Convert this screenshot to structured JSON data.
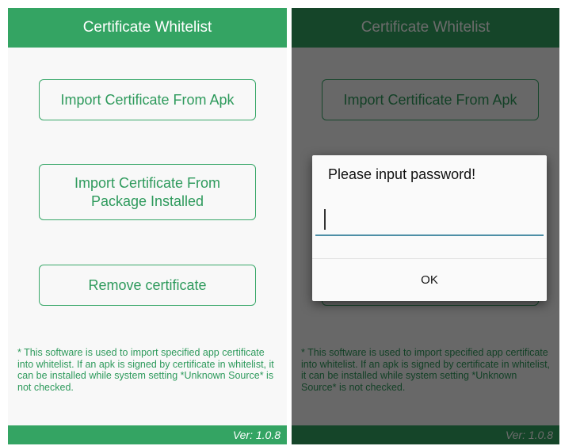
{
  "app": {
    "title": "Certificate Whitelist",
    "buttons": {
      "import_apk": "Import Certificate From Apk",
      "import_installed": "Import Certificate From Package Installed",
      "remove": "Remove certificate"
    },
    "footnote": "* This software is used to import specified app certificate into whitelist. If an apk is signed by certificate in whitelist, it can be installed while system setting *Unknown Source* is not checked.",
    "version": "Ver: 1.0.8"
  },
  "dialog": {
    "title": "Please input password!",
    "input_value": "",
    "ok_label": "OK"
  },
  "colors": {
    "accent": "#34a463",
    "text_green": "#2e9a5c",
    "input_underline": "#4e8fa6"
  }
}
